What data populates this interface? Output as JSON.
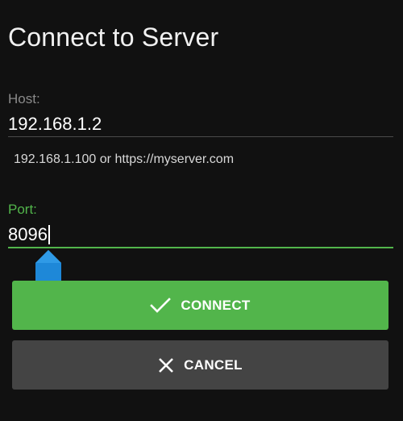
{
  "dialog": {
    "title": "Connect to Server"
  },
  "host": {
    "label": "Host:",
    "value": "192.168.1.2",
    "hint": "192.168.1.100 or https://myserver.com"
  },
  "port": {
    "label": "Port:",
    "value": "8096"
  },
  "buttons": {
    "connect_label": "CONNECT",
    "connect_icon": "check-icon",
    "cancel_label": "CANCEL",
    "cancel_icon": "close-icon"
  },
  "colors": {
    "accent": "#52b54b",
    "background": "#111111",
    "cancel_button": "#444444",
    "text_handle": "#1e88d8"
  }
}
